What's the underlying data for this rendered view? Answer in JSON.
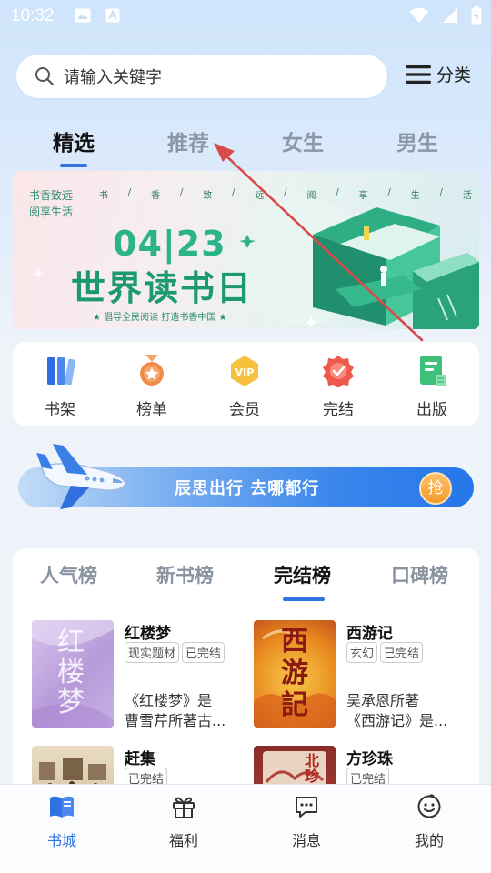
{
  "status_bar": {
    "time": "10:32"
  },
  "search": {
    "placeholder": "请输入关键字"
  },
  "category_label": "分类",
  "tabs": [
    {
      "label": "精选",
      "active": true
    },
    {
      "label": "推荐",
      "active": false
    },
    {
      "label": "女生",
      "active": false
    },
    {
      "label": "男生",
      "active": false
    }
  ],
  "banner": {
    "tag_line1": "书香致远",
    "tag_line2": "阅享生活",
    "slogan_chars": [
      "书",
      "/",
      "香",
      "/",
      "致",
      "/",
      "远",
      "/",
      "阅",
      "/",
      "享",
      "/",
      "生",
      "/",
      "活"
    ],
    "date": "04|23",
    "title": "世界读书日",
    "subtitle": "★ 倡导全民阅读 打造书香中国 ★"
  },
  "quick_entries": [
    {
      "label": "书架",
      "icon": "bookshelf-icon",
      "color": "#3b7be8"
    },
    {
      "label": "榜单",
      "icon": "medal-icon",
      "color": "#f0894a"
    },
    {
      "label": "会员",
      "icon": "vip-icon",
      "color": "#f5c24a"
    },
    {
      "label": "完结",
      "icon": "finished-badge-icon",
      "color": "#ef5a4d"
    },
    {
      "label": "出版",
      "icon": "publish-book-icon",
      "color": "#3fc07a"
    }
  ],
  "ad": {
    "text": "辰思出行 去哪都行",
    "button": "抢"
  },
  "rank_tabs": [
    {
      "label": "人气榜",
      "active": false
    },
    {
      "label": "新书榜",
      "active": false
    },
    {
      "label": "完结榜",
      "active": true
    },
    {
      "label": "口碑榜",
      "active": false
    }
  ],
  "books": [
    {
      "title": "红楼梦",
      "tags": [
        "现实题材",
        "已完结"
      ],
      "desc_line1": "《红楼梦》是",
      "desc_line2": "曹雪芹所著古...",
      "cover_text": "红楼梦"
    },
    {
      "title": "西游记",
      "tags": [
        "玄幻",
        "已完结"
      ],
      "desc_line1": "吴承恩所著",
      "desc_line2": "《西游记》是...",
      "cover_text": "西游記"
    },
    {
      "title": "赶集",
      "tags": [
        "已完结"
      ]
    },
    {
      "title": "方珍珠",
      "tags": [
        "已完结"
      ],
      "cover_text": "北珍"
    }
  ],
  "bottom_nav": [
    {
      "label": "书城",
      "icon": "book-city-icon",
      "active": true
    },
    {
      "label": "福利",
      "icon": "gift-icon",
      "active": false
    },
    {
      "label": "消息",
      "icon": "message-icon",
      "active": false
    },
    {
      "label": "我的",
      "icon": "smiley-profile-icon",
      "active": false
    }
  ],
  "colors": {
    "accent": "#2f72e0",
    "annotation_arrow": "#d94a4a"
  }
}
